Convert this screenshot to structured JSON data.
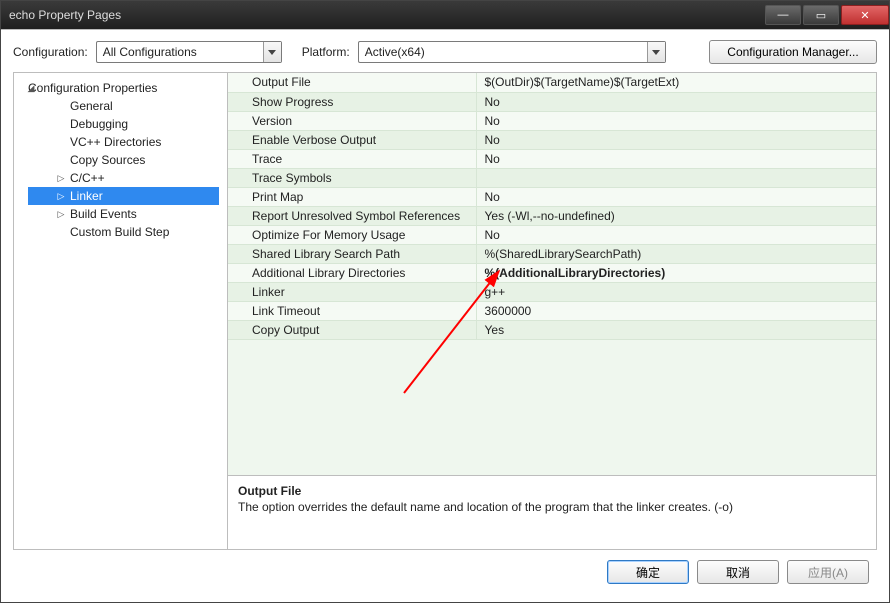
{
  "window": {
    "title": "echo Property Pages"
  },
  "toolbar": {
    "config_label": "Configuration:",
    "config_value": "All Configurations",
    "platform_label": "Platform:",
    "platform_value": "Active(x64)",
    "config_mgr_label": "Configuration Manager..."
  },
  "tree": {
    "root": "Configuration Properties",
    "items": {
      "general": "General",
      "debugging": "Debugging",
      "vcdirs": "VC++ Directories",
      "copysrc": "Copy Sources",
      "ccpp": "C/C++",
      "linker": "Linker",
      "buildevents": "Build Events",
      "custombuild": "Custom Build Step"
    }
  },
  "grid": {
    "rows": {
      "output_file": {
        "name": "Output File",
        "val": "$(OutDir)$(TargetName)$(TargetExt)"
      },
      "show_progress": {
        "name": "Show Progress",
        "val": "No"
      },
      "version": {
        "name": "Version",
        "val": "No"
      },
      "verbose": {
        "name": "Enable Verbose Output",
        "val": "No"
      },
      "trace": {
        "name": "Trace",
        "val": "No"
      },
      "trace_symbols": {
        "name": "Trace Symbols",
        "val": ""
      },
      "print_map": {
        "name": "Print Map",
        "val": "No"
      },
      "unresolved": {
        "name": "Report Unresolved Symbol References",
        "val": "Yes (-Wl,--no-undefined)"
      },
      "opt_mem": {
        "name": "Optimize For Memory Usage",
        "val": "No"
      },
      "shlib_path": {
        "name": "Shared Library Search Path",
        "val": "%(SharedLibrarySearchPath)"
      },
      "addl_lib_dirs": {
        "name": "Additional Library Directories",
        "val": "%(AdditionalLibraryDirectories)"
      },
      "linker": {
        "name": "Linker",
        "val": "g++"
      },
      "link_timeout": {
        "name": "Link Timeout",
        "val": "3600000"
      },
      "copy_output": {
        "name": "Copy Output",
        "val": "Yes"
      }
    }
  },
  "help": {
    "title": "Output File",
    "body": "The option overrides the default name and location of the program that the linker creates. (-o)"
  },
  "buttons": {
    "ok": "确定",
    "cancel": "取消",
    "apply": "应用(A)"
  }
}
